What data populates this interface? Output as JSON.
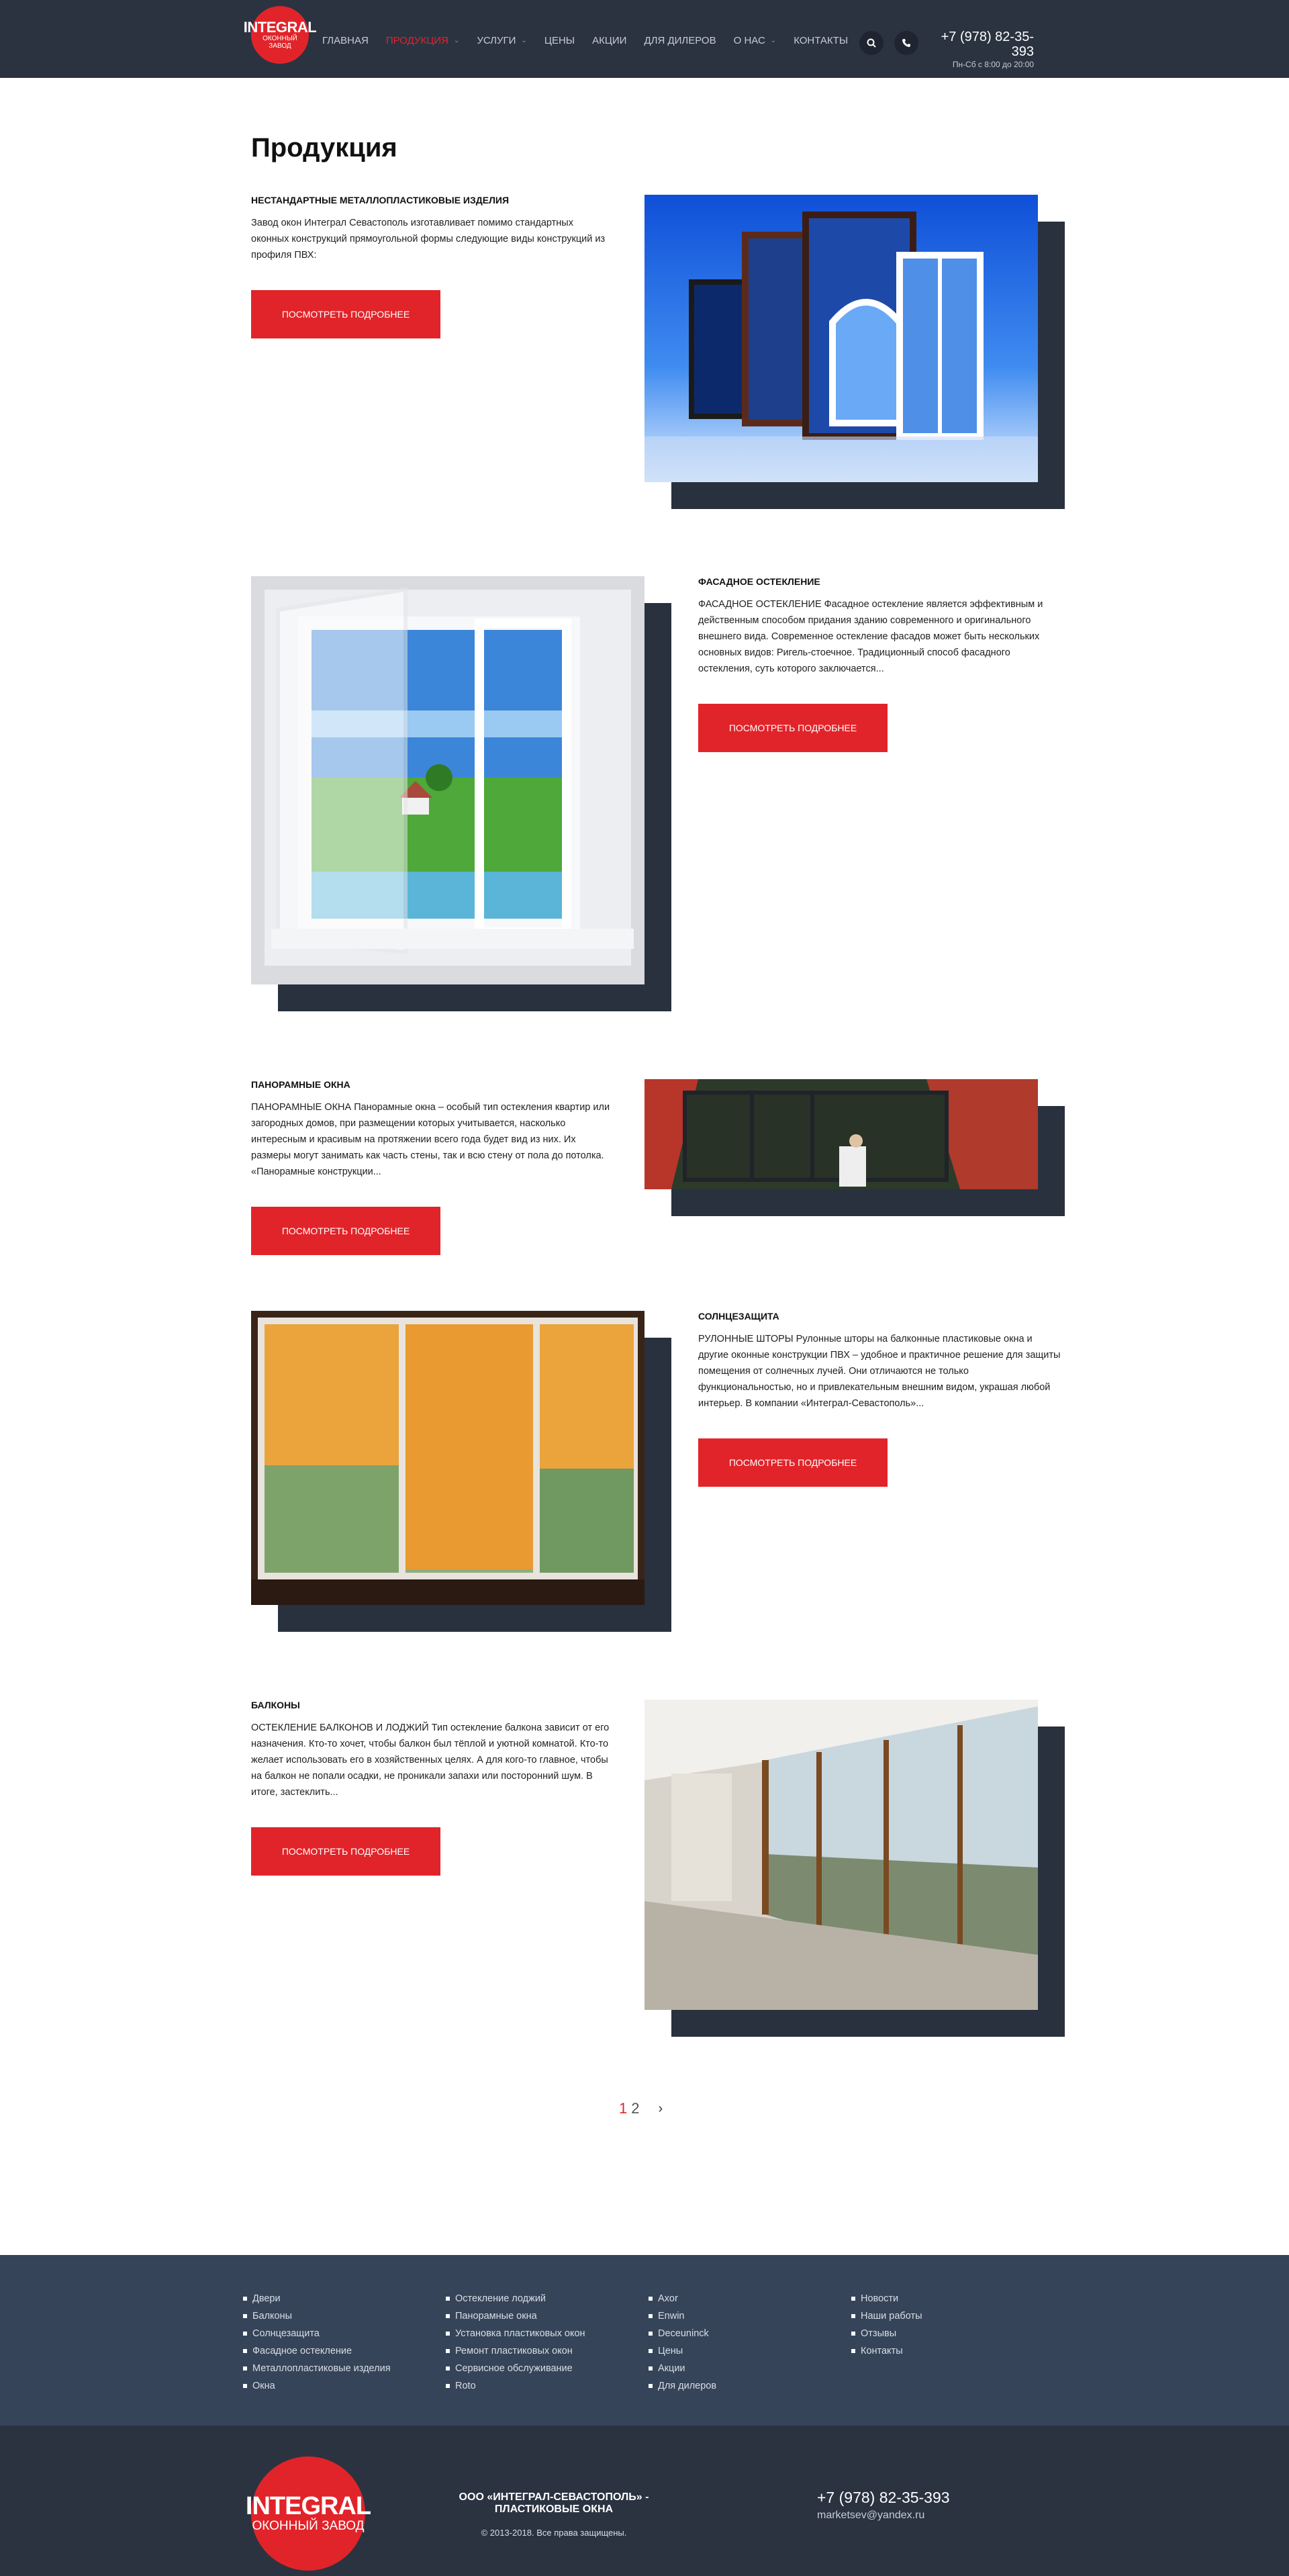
{
  "header": {
    "logo_title": "INTEGRAL",
    "logo_subtitle": "ОКОННЫЙ ЗАВОД",
    "nav": [
      {
        "label": "Главная",
        "active": false,
        "caret": false
      },
      {
        "label": "Продукция",
        "active": true,
        "caret": true
      },
      {
        "label": "Услуги",
        "active": false,
        "caret": true
      },
      {
        "label": "Цены",
        "active": false,
        "caret": false
      },
      {
        "label": "Акции",
        "active": false,
        "caret": false
      },
      {
        "label": "Для дилеров",
        "active": false,
        "caret": false
      },
      {
        "label": "О нас",
        "active": false,
        "caret": true
      },
      {
        "label": "Контакты",
        "active": false,
        "caret": false
      }
    ],
    "search_icon": "search-icon",
    "phone_icon": "phone-icon",
    "phone": "+7 (978) 82-35-393",
    "hours": "Пн-Сб с 8:00 до 20:00"
  },
  "page": {
    "title": "Продукция"
  },
  "products": [
    {
      "title": "НЕСТАНДАРТНЫЕ МЕТАЛЛОПЛАСТИКОВЫЕ ИЗДЕЛИЯ",
      "text": "Завод окон Интеграл Севастополь изготавливает помимо стандартных оконных конструкций  прямоугольной формы следующие виды конструкций из профиля ПВХ:",
      "button": "Посмотреть подробнее"
    },
    {
      "title": "ФАСАДНОЕ ОСТЕКЛЕНИЕ",
      "text": "ФАСАДНОЕ ОСТЕКЛЕНИЕ Фасадное остекление является эффективным и действенным способом придания зданию современного и оригинального внешнего вида. Современное остекление фасадов может быть нескольких основных видов: Ригель-стоечное. Традиционный способ фасадного остекления, суть которого заключается...",
      "button": "Посмотреть подробнее"
    },
    {
      "title": "ПАНОРАМНЫЕ ОКНА",
      "text": "ПАНОРАМНЫЕ ОКНА Панорамные окна – особый тип остекления квартир или загородных домов, при размещении которых учитывается, насколько интересным и красивым на протяжении всего года будет вид из них. Их размеры могут занимать как часть стены, так и всю стену от пола до потолка. «Панорамные конструкции...",
      "button": "Посмотреть подробнее"
    },
    {
      "title": "СОЛНЦЕЗАЩИТА",
      "text": "РУЛОННЫЕ ШТОРЫ Рулонные шторы на балконные пластиковые окна и другие оконные конструкции ПВХ – удобное и практичное решение для защиты помещения от солнечных лучей. Они отличаются не только функциональностью, но и привлекательным внешним видом, украшая любой интерьер. В компании «Интеграл-Севастополь»...",
      "button": "Посмотреть подробнее"
    },
    {
      "title": "БАЛКОНЫ",
      "text": "ОСТЕКЛЕНИЕ БАЛКОНОВ И ЛОДЖИЙ Тип остекление балкона зависит от его назначения. Кто-то хочет, чтобы балкон был тёплой и уютной комнатой. Кто-то желает использовать его в хозяйственных целях. А для кого-то главное, чтобы на балкон не попали осадки, не проникали запахи или посторонний шум. В итоге, застеклить...",
      "button": "Посмотреть подробнее"
    }
  ],
  "pagination": {
    "page1": "1",
    "page2": "2",
    "next": "›"
  },
  "footer": {
    "col1": [
      "Двери",
      "Балконы",
      "Солнцезащита",
      "Фасадное остекление",
      "Металлопластиковые изделия",
      "Окна"
    ],
    "col2": [
      "Остекление лоджий",
      "Панорамные окна",
      "Установка пластиковых окон",
      "Ремонт пластиковых окон",
      "Сервисное обслуживание",
      "Roto"
    ],
    "col3": [
      "Axor",
      "Enwin",
      "Deceuninck",
      "Цены",
      "Акции",
      "Для дилеров"
    ],
    "col4": [
      "Новости",
      "Наши работы",
      "Отзывы",
      "Контакты"
    ],
    "logo_title": "INTEGRAL",
    "logo_subtitle": "ОКОННЫЙ ЗАВОД",
    "company": "ООО «ИНТЕГРАЛ-СЕВАСТОПОЛЬ» - ПЛАСТИКОВЫЕ ОКНА",
    "copyright": "© 2013-2018. Все права защищены.",
    "phone": "+7 (978) 82-35-393",
    "email": "marketsev@yandex.ru"
  },
  "colors": {
    "accent": "#e1242a",
    "header_bg": "#2b3341",
    "footer_links_bg": "#364459",
    "shadow_block": "#28313d"
  }
}
